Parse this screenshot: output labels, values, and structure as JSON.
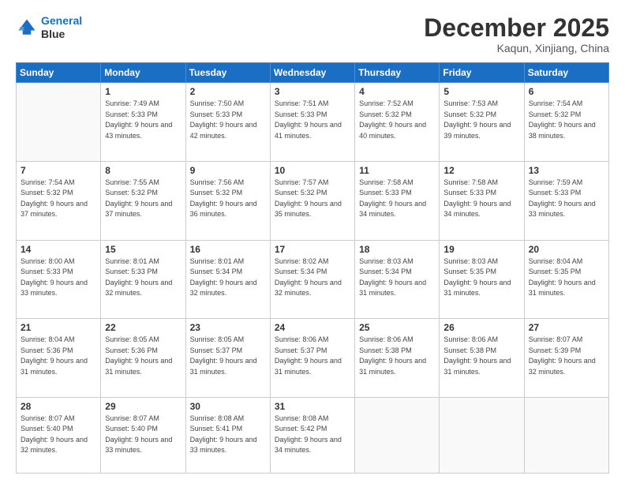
{
  "header": {
    "logo_line1": "General",
    "logo_line2": "Blue",
    "month": "December 2025",
    "location": "Kaqun, Xinjiang, China"
  },
  "weekdays": [
    "Sunday",
    "Monday",
    "Tuesday",
    "Wednesday",
    "Thursday",
    "Friday",
    "Saturday"
  ],
  "weeks": [
    [
      {
        "day": "",
        "sunrise": "",
        "sunset": "",
        "daylight": ""
      },
      {
        "day": "1",
        "sunrise": "Sunrise: 7:49 AM",
        "sunset": "Sunset: 5:33 PM",
        "daylight": "Daylight: 9 hours and 43 minutes."
      },
      {
        "day": "2",
        "sunrise": "Sunrise: 7:50 AM",
        "sunset": "Sunset: 5:33 PM",
        "daylight": "Daylight: 9 hours and 42 minutes."
      },
      {
        "day": "3",
        "sunrise": "Sunrise: 7:51 AM",
        "sunset": "Sunset: 5:33 PM",
        "daylight": "Daylight: 9 hours and 41 minutes."
      },
      {
        "day": "4",
        "sunrise": "Sunrise: 7:52 AM",
        "sunset": "Sunset: 5:32 PM",
        "daylight": "Daylight: 9 hours and 40 minutes."
      },
      {
        "day": "5",
        "sunrise": "Sunrise: 7:53 AM",
        "sunset": "Sunset: 5:32 PM",
        "daylight": "Daylight: 9 hours and 39 minutes."
      },
      {
        "day": "6",
        "sunrise": "Sunrise: 7:54 AM",
        "sunset": "Sunset: 5:32 PM",
        "daylight": "Daylight: 9 hours and 38 minutes."
      }
    ],
    [
      {
        "day": "7",
        "sunrise": "Sunrise: 7:54 AM",
        "sunset": "Sunset: 5:32 PM",
        "daylight": "Daylight: 9 hours and 37 minutes."
      },
      {
        "day": "8",
        "sunrise": "Sunrise: 7:55 AM",
        "sunset": "Sunset: 5:32 PM",
        "daylight": "Daylight: 9 hours and 37 minutes."
      },
      {
        "day": "9",
        "sunrise": "Sunrise: 7:56 AM",
        "sunset": "Sunset: 5:32 PM",
        "daylight": "Daylight: 9 hours and 36 minutes."
      },
      {
        "day": "10",
        "sunrise": "Sunrise: 7:57 AM",
        "sunset": "Sunset: 5:32 PM",
        "daylight": "Daylight: 9 hours and 35 minutes."
      },
      {
        "day": "11",
        "sunrise": "Sunrise: 7:58 AM",
        "sunset": "Sunset: 5:33 PM",
        "daylight": "Daylight: 9 hours and 34 minutes."
      },
      {
        "day": "12",
        "sunrise": "Sunrise: 7:58 AM",
        "sunset": "Sunset: 5:33 PM",
        "daylight": "Daylight: 9 hours and 34 minutes."
      },
      {
        "day": "13",
        "sunrise": "Sunrise: 7:59 AM",
        "sunset": "Sunset: 5:33 PM",
        "daylight": "Daylight: 9 hours and 33 minutes."
      }
    ],
    [
      {
        "day": "14",
        "sunrise": "Sunrise: 8:00 AM",
        "sunset": "Sunset: 5:33 PM",
        "daylight": "Daylight: 9 hours and 33 minutes."
      },
      {
        "day": "15",
        "sunrise": "Sunrise: 8:01 AM",
        "sunset": "Sunset: 5:33 PM",
        "daylight": "Daylight: 9 hours and 32 minutes."
      },
      {
        "day": "16",
        "sunrise": "Sunrise: 8:01 AM",
        "sunset": "Sunset: 5:34 PM",
        "daylight": "Daylight: 9 hours and 32 minutes."
      },
      {
        "day": "17",
        "sunrise": "Sunrise: 8:02 AM",
        "sunset": "Sunset: 5:34 PM",
        "daylight": "Daylight: 9 hours and 32 minutes."
      },
      {
        "day": "18",
        "sunrise": "Sunrise: 8:03 AM",
        "sunset": "Sunset: 5:34 PM",
        "daylight": "Daylight: 9 hours and 31 minutes."
      },
      {
        "day": "19",
        "sunrise": "Sunrise: 8:03 AM",
        "sunset": "Sunset: 5:35 PM",
        "daylight": "Daylight: 9 hours and 31 minutes."
      },
      {
        "day": "20",
        "sunrise": "Sunrise: 8:04 AM",
        "sunset": "Sunset: 5:35 PM",
        "daylight": "Daylight: 9 hours and 31 minutes."
      }
    ],
    [
      {
        "day": "21",
        "sunrise": "Sunrise: 8:04 AM",
        "sunset": "Sunset: 5:36 PM",
        "daylight": "Daylight: 9 hours and 31 minutes."
      },
      {
        "day": "22",
        "sunrise": "Sunrise: 8:05 AM",
        "sunset": "Sunset: 5:36 PM",
        "daylight": "Daylight: 9 hours and 31 minutes."
      },
      {
        "day": "23",
        "sunrise": "Sunrise: 8:05 AM",
        "sunset": "Sunset: 5:37 PM",
        "daylight": "Daylight: 9 hours and 31 minutes."
      },
      {
        "day": "24",
        "sunrise": "Sunrise: 8:06 AM",
        "sunset": "Sunset: 5:37 PM",
        "daylight": "Daylight: 9 hours and 31 minutes."
      },
      {
        "day": "25",
        "sunrise": "Sunrise: 8:06 AM",
        "sunset": "Sunset: 5:38 PM",
        "daylight": "Daylight: 9 hours and 31 minutes."
      },
      {
        "day": "26",
        "sunrise": "Sunrise: 8:06 AM",
        "sunset": "Sunset: 5:38 PM",
        "daylight": "Daylight: 9 hours and 31 minutes."
      },
      {
        "day": "27",
        "sunrise": "Sunrise: 8:07 AM",
        "sunset": "Sunset: 5:39 PM",
        "daylight": "Daylight: 9 hours and 32 minutes."
      }
    ],
    [
      {
        "day": "28",
        "sunrise": "Sunrise: 8:07 AM",
        "sunset": "Sunset: 5:40 PM",
        "daylight": "Daylight: 9 hours and 32 minutes."
      },
      {
        "day": "29",
        "sunrise": "Sunrise: 8:07 AM",
        "sunset": "Sunset: 5:40 PM",
        "daylight": "Daylight: 9 hours and 33 minutes."
      },
      {
        "day": "30",
        "sunrise": "Sunrise: 8:08 AM",
        "sunset": "Sunset: 5:41 PM",
        "daylight": "Daylight: 9 hours and 33 minutes."
      },
      {
        "day": "31",
        "sunrise": "Sunrise: 8:08 AM",
        "sunset": "Sunset: 5:42 PM",
        "daylight": "Daylight: 9 hours and 34 minutes."
      },
      {
        "day": "",
        "sunrise": "",
        "sunset": "",
        "daylight": ""
      },
      {
        "day": "",
        "sunrise": "",
        "sunset": "",
        "daylight": ""
      },
      {
        "day": "",
        "sunrise": "",
        "sunset": "",
        "daylight": ""
      }
    ]
  ]
}
